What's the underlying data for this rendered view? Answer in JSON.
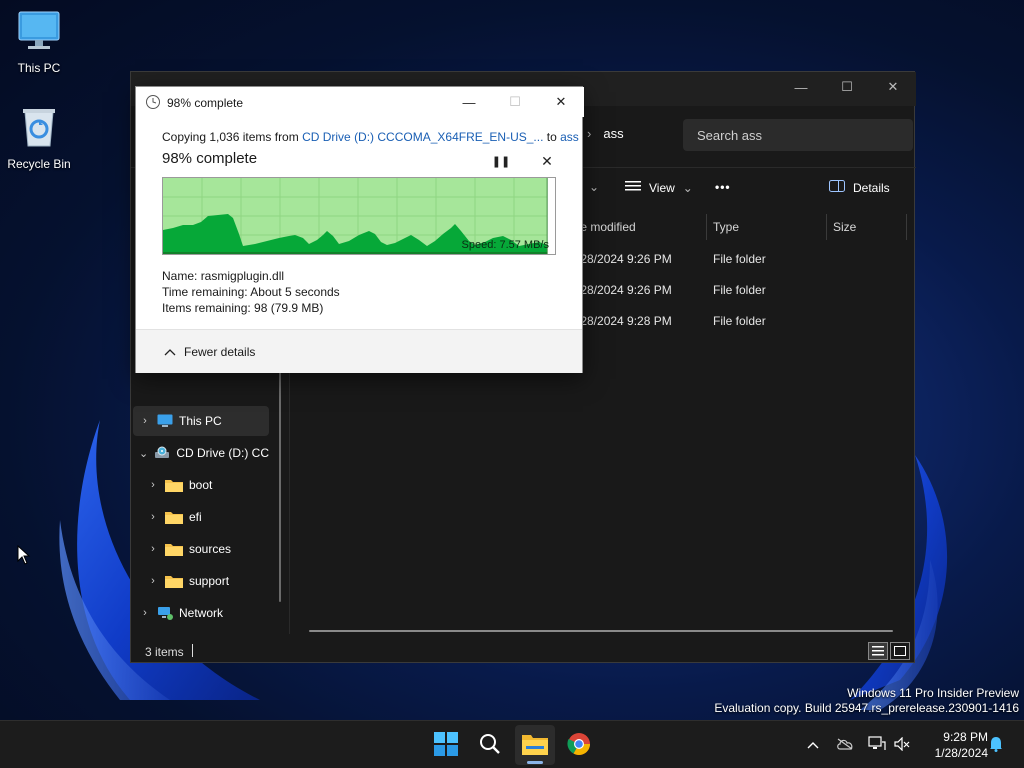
{
  "desktop": {
    "icons": [
      {
        "label": "This PC",
        "icon": "monitor-icon"
      },
      {
        "label": "Recycle Bin",
        "icon": "recycle-bin-icon"
      }
    ]
  },
  "explorer": {
    "breadcrumb": "ass",
    "search_placeholder": "Search ass",
    "toolbar": {
      "view_label": "View",
      "more_label": "•••",
      "details_label": "Details"
    },
    "columns": {
      "modified": "te modified",
      "type": "Type",
      "size": "Size"
    },
    "rows": [
      {
        "modified": "/28/2024 9:26 PM",
        "type": "File folder"
      },
      {
        "modified": "/28/2024 9:26 PM",
        "type": "File folder"
      },
      {
        "modified": "/28/2024 9:28 PM",
        "type": "File folder"
      }
    ],
    "nav": [
      {
        "label": "This PC",
        "chevron": "›"
      },
      {
        "label": "CD Drive (D:) CC",
        "chevron": "⌄"
      },
      {
        "label": "boot",
        "chevron": "›"
      },
      {
        "label": "efi",
        "chevron": "›"
      },
      {
        "label": "sources",
        "chevron": "›"
      },
      {
        "label": "support",
        "chevron": "›"
      },
      {
        "label": "Network",
        "chevron": "›"
      }
    ],
    "status": {
      "count": "3 items"
    }
  },
  "copy_dialog": {
    "title": "98% complete",
    "copy_prefix": "Copying 1,036 items from ",
    "source": "CD Drive (D:) CCCOMA_X64FRE_EN-US_...",
    "to_word": " to ",
    "dest": "ass",
    "percent_label": "98% complete",
    "progress_fraction": 0.98,
    "speed": "Speed: 7.57 MB/s",
    "name_label": "Name:",
    "name_value": "rasmigplugin.dll",
    "time_label": "Time remaining:",
    "time_value": "About 5 seconds",
    "items_label": "Items remaining:",
    "items_value": "98 (79.9 MB)",
    "fewer_details": "Fewer details",
    "colors": {
      "graph_fill": "#06a838",
      "graph_bg": "#a6e69a"
    }
  },
  "watermark": {
    "line1": "Windows 11 Pro Insider Preview",
    "line2": "Evaluation copy. Build 25947.rs_prerelease.230901-1416"
  },
  "taskbar": {
    "apps": [
      "windows-start-icon",
      "search-icon",
      "file-explorer-icon",
      "chrome-icon"
    ],
    "time": "9:28 PM",
    "date": "1/28/2024"
  }
}
